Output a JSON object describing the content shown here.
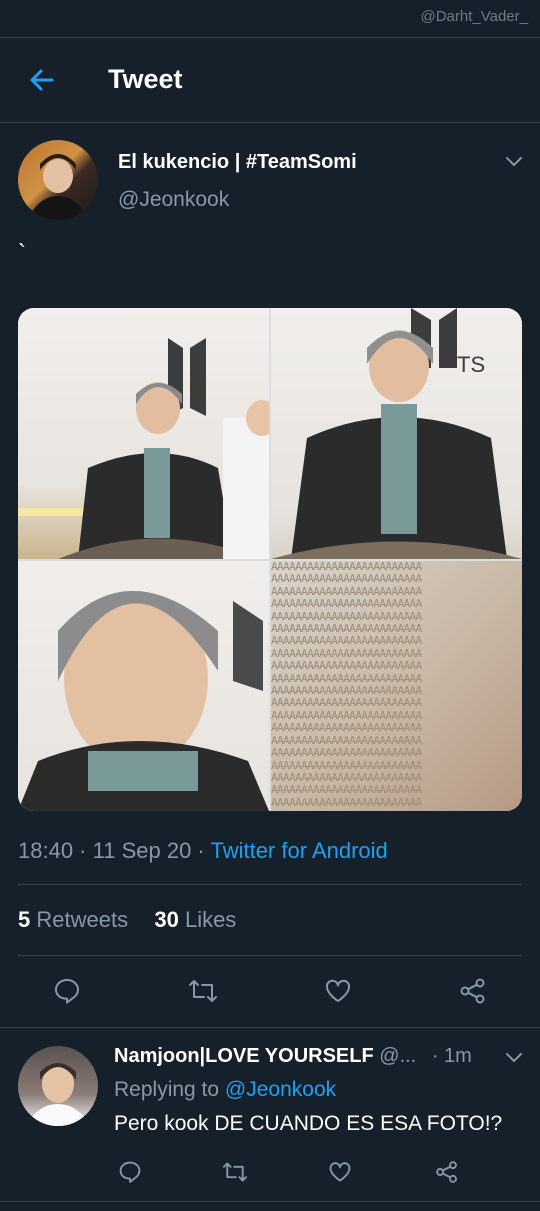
{
  "watermark": "@Darht_Vader_",
  "header": {
    "title": "Tweet"
  },
  "tweet": {
    "author_name": "El kukencio | #TeamSomi",
    "author_handle": "@Jeonkook",
    "text": "`",
    "time": "18:40",
    "date": "11 Sep 20",
    "source": "Twitter for Android",
    "retweets_count": "5",
    "retweets_label": "Retweets",
    "likes_count": "30",
    "likes_label": "Likes",
    "photo_text": {
      "brand_letters": "TS",
      "aaa_pattern": "AAAAAAAAAAAAAAAAAAAAAAAAA"
    }
  },
  "reply": {
    "author_name": "Namjoon|LOVE YOURSELF",
    "author_handle": "@...",
    "time": "· 1m",
    "replying_prefix": "Replying to",
    "replying_to": "@Jeonkook",
    "text": "Pero kook DE CUANDO ES ESA FOTO!?"
  },
  "colors": {
    "bg": "#15202b",
    "accent": "#1da1f2",
    "muted": "#8899a6",
    "divider": "#38444d"
  },
  "icons": [
    "back-arrow-icon",
    "chevron-down-icon",
    "reply-icon",
    "retweet-icon",
    "like-icon",
    "share-icon"
  ]
}
